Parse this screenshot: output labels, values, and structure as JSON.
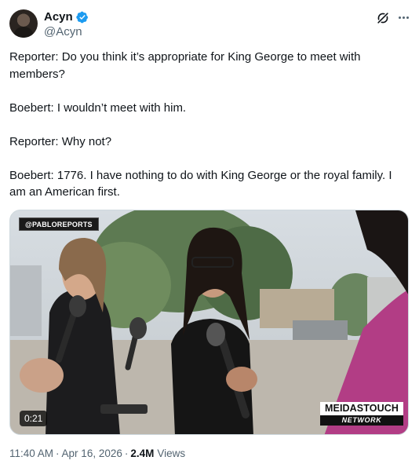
{
  "author": {
    "display_name": "Acyn",
    "handle": "@Acyn",
    "verified": true,
    "verified_color": "#1d9bf0"
  },
  "tweet": {
    "paragraphs": [
      "Reporter: Do you think it’s appropriate for King George to meet with members?",
      "Boebert: I wouldn’t meet with him.",
      "Reporter: Why not?",
      "Boebert: 1776. I have nothing to do with King George or the royal family. I am an American first."
    ]
  },
  "media": {
    "watermark_tag": "@PABLOREPORTS",
    "duration": "0:21",
    "logo_line1": "MEIDASTOUCH",
    "logo_line2": "NETWORK"
  },
  "meta": {
    "time": "11:40 AM",
    "separator": "·",
    "date": "Apr 16, 2026",
    "views_count": "2.4M",
    "views_label": "Views"
  },
  "icons": {
    "verified": "verified-badge-icon",
    "grok": "grok-icon",
    "more": "more-options-icon"
  },
  "colors": {
    "text_primary": "#0f1419",
    "text_secondary": "#536471",
    "border": "#cfd9de"
  }
}
